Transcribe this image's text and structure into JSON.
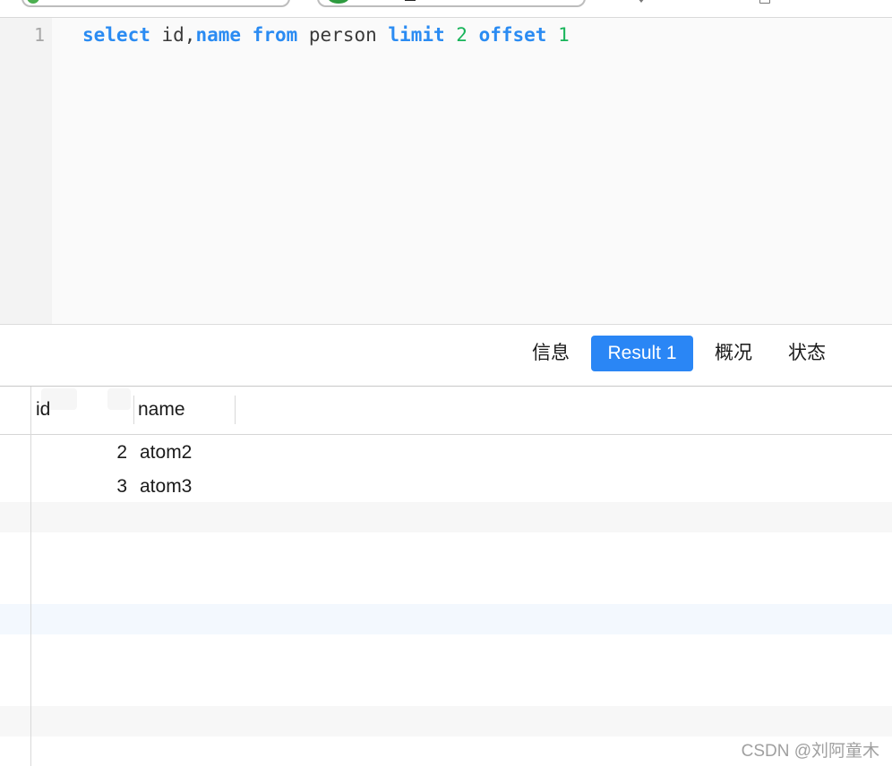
{
  "editor": {
    "line_number": "1",
    "tokens": {
      "kw_select": "select",
      "cols_id": " id,",
      "kw_name": "name",
      "space1": " ",
      "kw_from": "from",
      "table": " person ",
      "kw_limit": "limit",
      "space2": " ",
      "limit_value": "2",
      "space3": " ",
      "kw_offset": "offset",
      "space4": " ",
      "offset_value": "1"
    }
  },
  "tabs": {
    "info": "信息",
    "result": "Result 1",
    "overview": "概况",
    "status": "状态",
    "active": "Result 1"
  },
  "grid": {
    "columns": [
      "id",
      "name"
    ],
    "rows": [
      {
        "id": "2",
        "name": "atom2"
      },
      {
        "id": "3",
        "name": "atom3"
      }
    ]
  },
  "watermark": "CSDN @刘阿童木",
  "colors": {
    "keyword": "#2a8bf2",
    "number": "#18b45a",
    "active_tab": "#2a86f5"
  }
}
